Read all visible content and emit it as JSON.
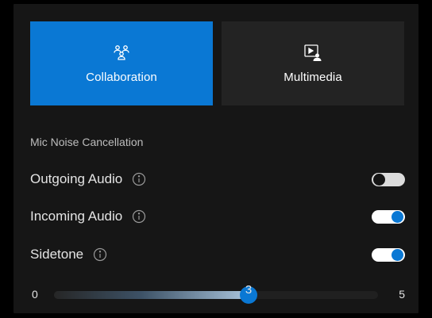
{
  "tabs": [
    {
      "label": "Collaboration",
      "icon": "collaboration-people-icon",
      "selected": true
    },
    {
      "label": "Multimedia",
      "icon": "multimedia-presenter-icon",
      "selected": false
    }
  ],
  "section_label": "Mic Noise Cancellation",
  "settings": [
    {
      "label": "Outgoing Audio",
      "icon": "info-icon",
      "enabled": false
    },
    {
      "label": "Incoming Audio",
      "icon": "info-icon",
      "enabled": true
    },
    {
      "label": "Sidetone",
      "icon": "info-icon",
      "enabled": true
    }
  ],
  "sidetone_slider": {
    "min": "0",
    "max": "5",
    "value": "3",
    "value_fraction": 0.6
  },
  "colors": {
    "accent": "#0a78d4",
    "panel": "#161616",
    "tab_inactive": "#232323"
  }
}
